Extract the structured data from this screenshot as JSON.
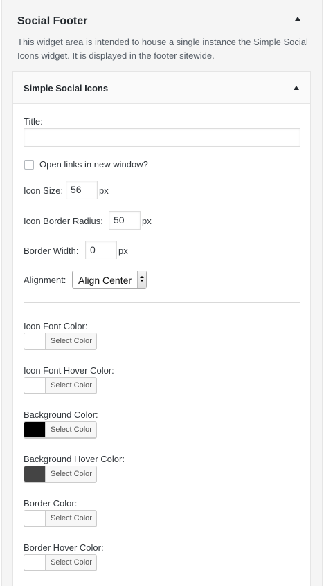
{
  "sidebar": {
    "title": "Social Footer",
    "description": "This widget area is intended to house a single instance the Simple Social Icons widget. It is displayed in the footer sitewide."
  },
  "widget": {
    "title": "Simple Social Icons",
    "fields": {
      "title_label": "Title:",
      "title_value": "",
      "new_window_label": "Open links in new window?",
      "new_window_checked": false,
      "icon_size_label": "Icon Size:",
      "icon_size_value": "56",
      "icon_border_radius_label": "Icon Border Radius:",
      "icon_border_radius_value": "50",
      "border_width_label": "Border Width:",
      "border_width_value": "0",
      "unit": "px",
      "alignment_label": "Alignment:",
      "alignment_value": "Align Center"
    },
    "colors": [
      {
        "label": "Icon Font Color:",
        "button": "Select Color",
        "swatch": "#ffffff"
      },
      {
        "label": "Icon Font Hover Color:",
        "button": "Select Color",
        "swatch": "#ffffff"
      },
      {
        "label": "Background Color:",
        "button": "Select Color",
        "swatch": "#000000"
      },
      {
        "label": "Background Hover Color:",
        "button": "Select Color",
        "swatch": "#444444"
      },
      {
        "label": "Border Color:",
        "button": "Select Color",
        "swatch": "#ffffff"
      },
      {
        "label": "Border Hover Color:",
        "button": "Select Color",
        "swatch": "#ffffff"
      }
    ]
  }
}
